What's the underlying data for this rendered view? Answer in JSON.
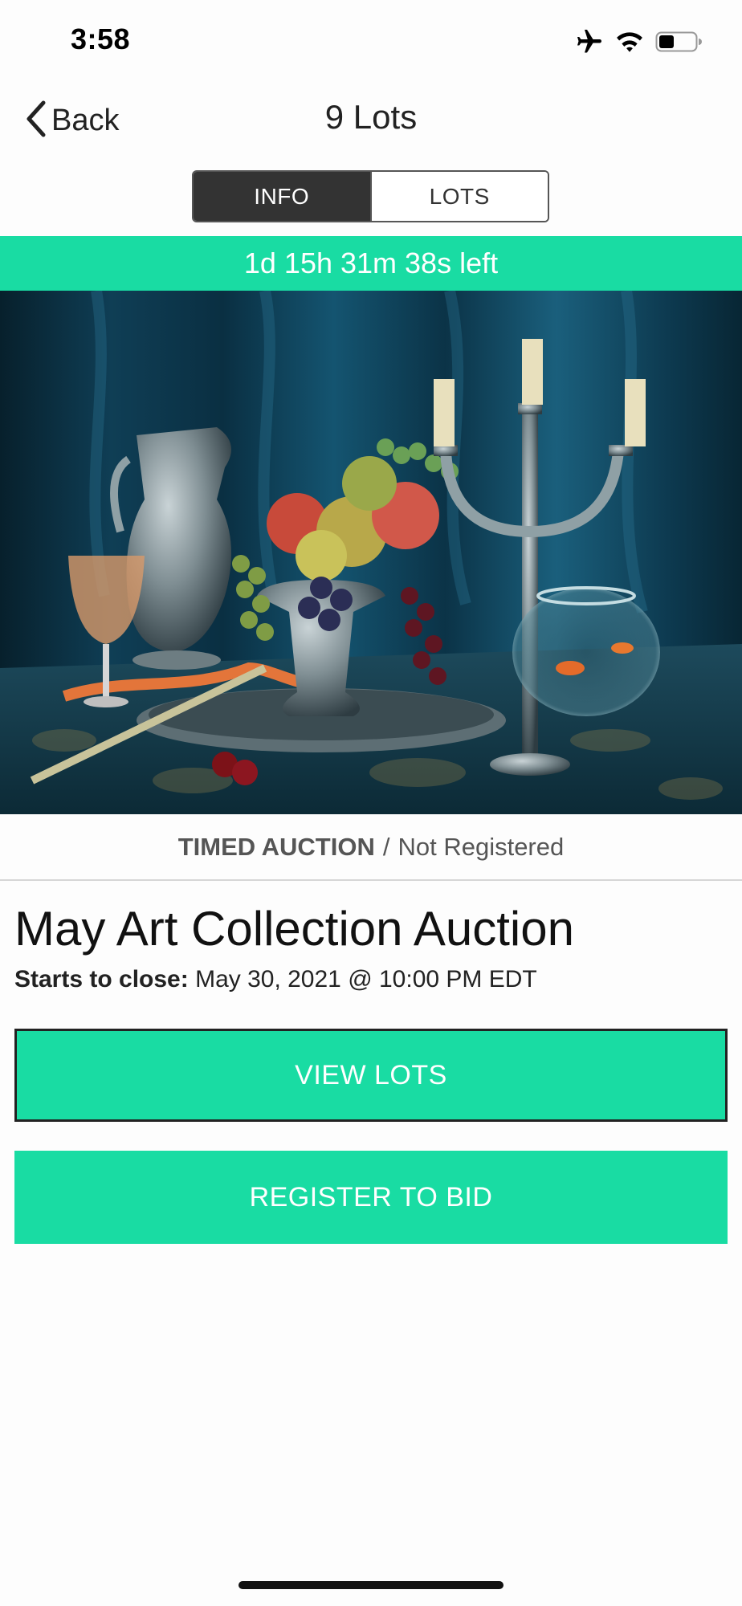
{
  "status_bar": {
    "time": "3:58",
    "icons": [
      "airplane-mode-icon",
      "wifi-icon",
      "battery-icon"
    ]
  },
  "nav": {
    "back_label": "Back",
    "title": "9 Lots"
  },
  "segments": {
    "info_label": "INFO",
    "lots_label": "LOTS",
    "selected": "INFO"
  },
  "countdown": {
    "text": "1d 15h 31m 38s left"
  },
  "auction": {
    "type_label": "TIMED AUCTION",
    "separator": "/",
    "registration_status": "Not Registered",
    "title": "May Art Collection Auction",
    "close_label": "Starts to close:",
    "close_value": "May 30, 2021 @ 10:00 PM EDT"
  },
  "buttons": {
    "view_lots": "VIEW LOTS",
    "register": "REGISTER TO BID"
  },
  "colors": {
    "accent": "#19dca3",
    "segment_active": "#333333",
    "text_dark": "#111111",
    "text_muted": "#555555"
  }
}
